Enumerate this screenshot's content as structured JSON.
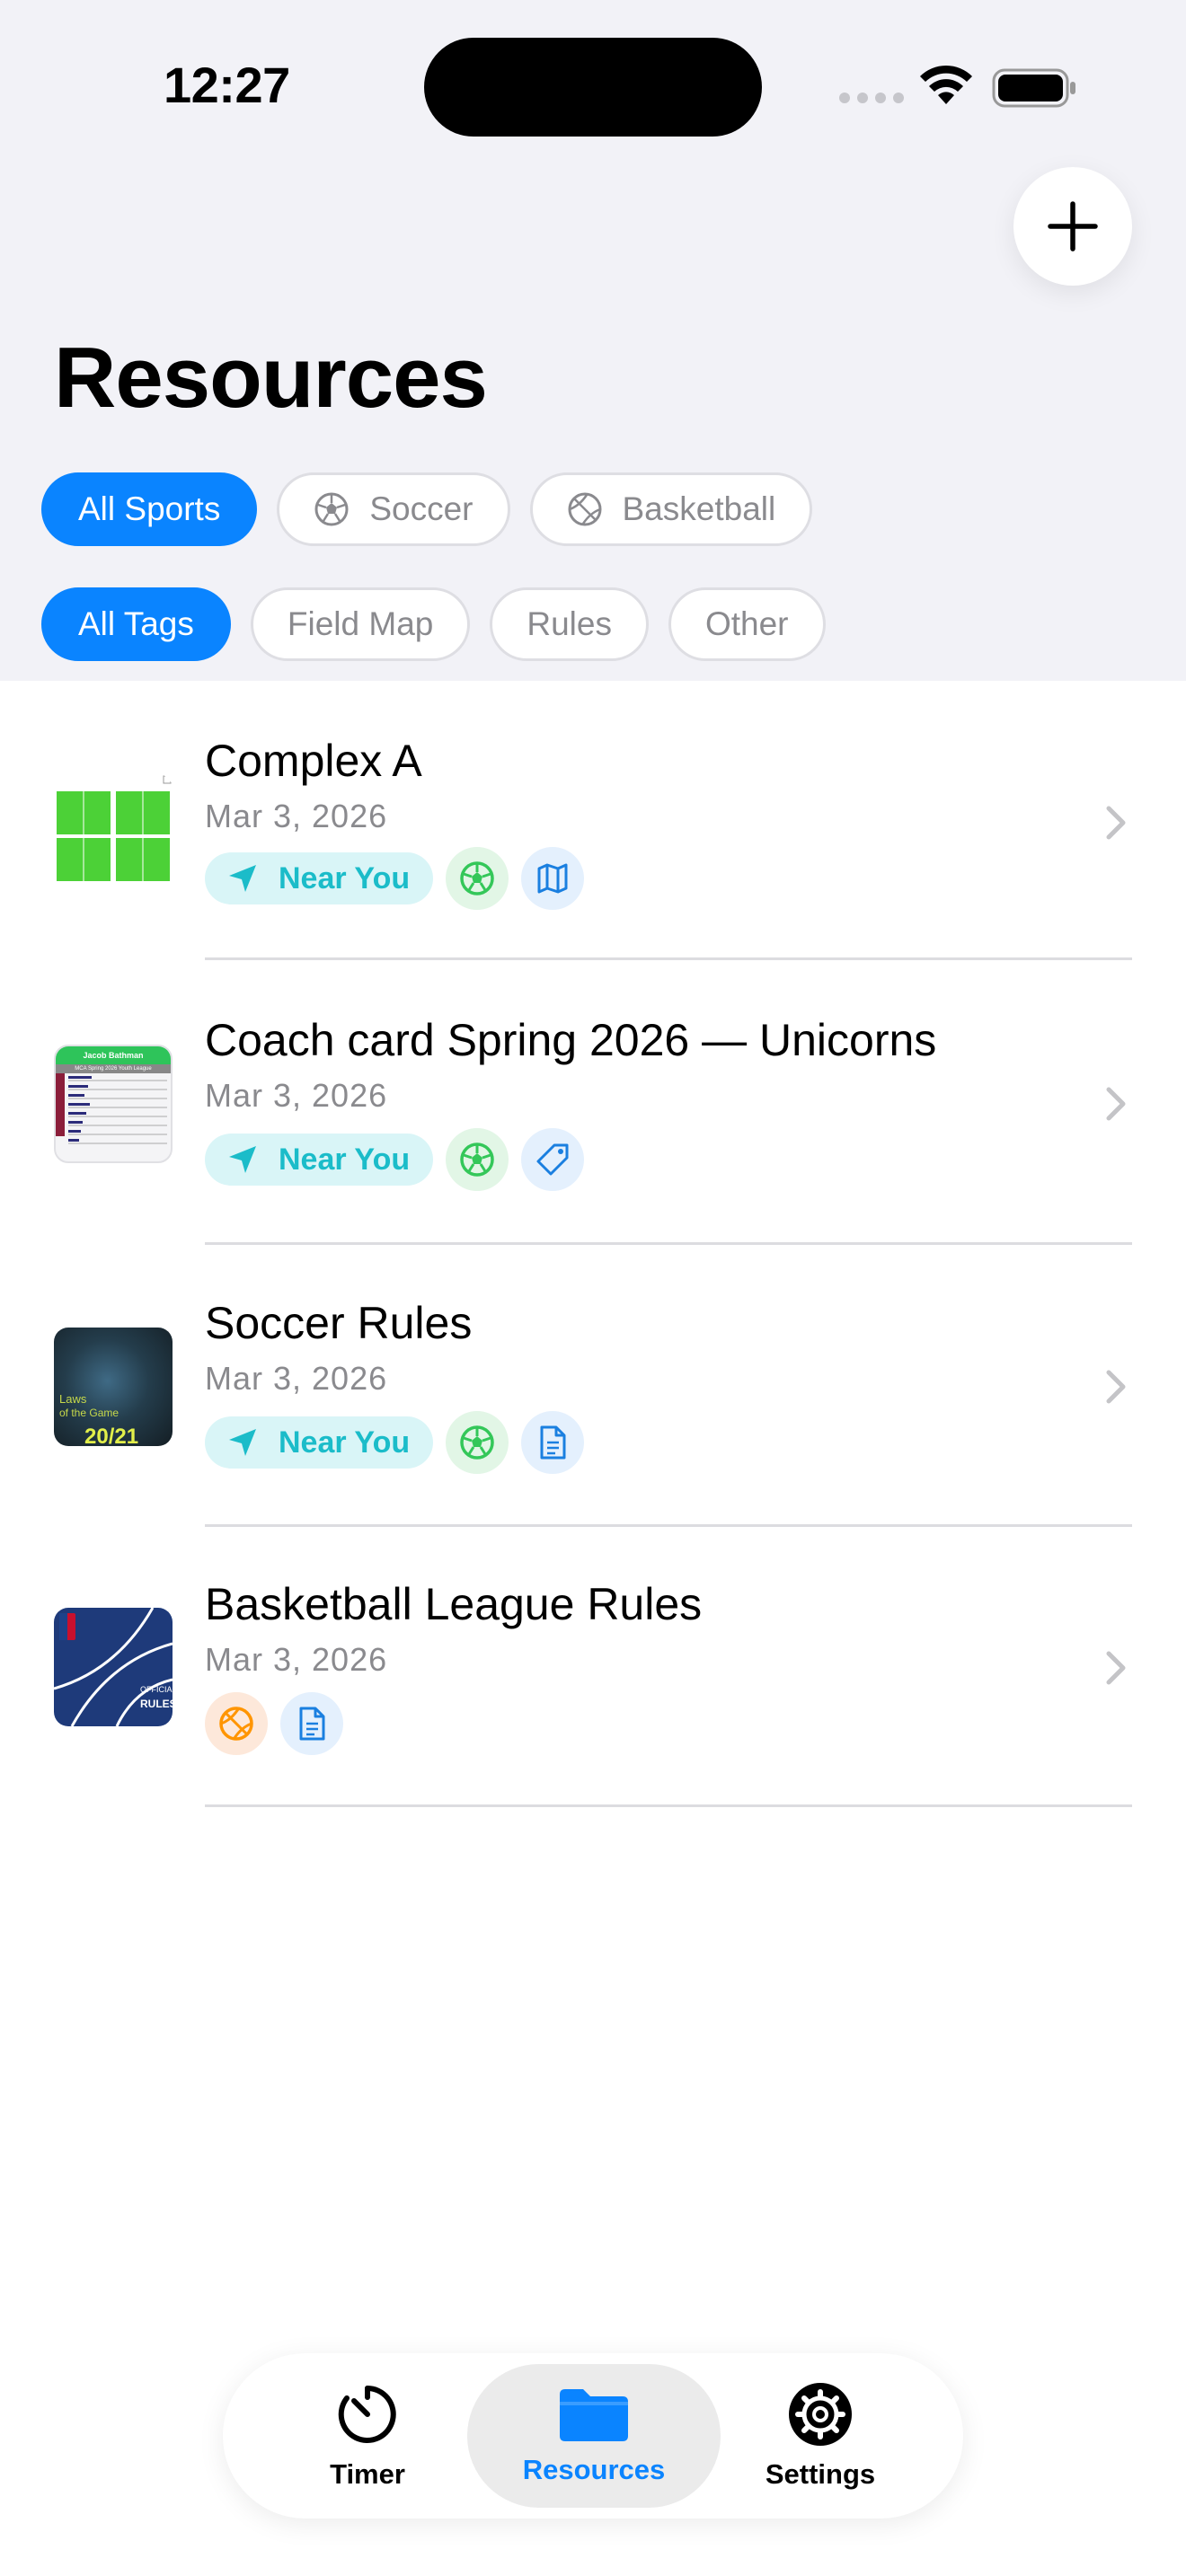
{
  "status_bar": {
    "time": "12:27"
  },
  "page": {
    "title": "Resources"
  },
  "filters": {
    "sports": [
      {
        "label": "All Sports",
        "active": true,
        "icon": ""
      },
      {
        "label": "Soccer",
        "active": false,
        "icon": "soccer-ball-icon"
      },
      {
        "label": "Basketball",
        "active": false,
        "icon": "basketball-icon"
      }
    ],
    "tags": [
      {
        "label": "All Tags",
        "active": true
      },
      {
        "label": "Field Map",
        "active": false
      },
      {
        "label": "Rules",
        "active": false
      },
      {
        "label": "Other",
        "active": false
      }
    ]
  },
  "resources": [
    {
      "title": "Complex A",
      "date": "Mar 3, 2026",
      "near_you": "Near You",
      "sport_icon": "soccer-ball-icon",
      "tag_icon": "map-icon"
    },
    {
      "title": " Coach card Spring 2026 — Unicorns",
      "date": "Mar 3, 2026",
      "near_you": "Near You",
      "sport_icon": "soccer-ball-icon",
      "tag_icon": "tag-icon",
      "thumb_header": "Jacob Bathman",
      "thumb_sub": "MCA Spring 2026 Youth League"
    },
    {
      "title": "Soccer Rules",
      "date": "Mar 3, 2026",
      "near_you": "Near You",
      "sport_icon": "soccer-ball-icon",
      "tag_icon": "document-icon",
      "thumb_text_1": "Laws",
      "thumb_text_2": "of the Game",
      "thumb_text_3": "20/21"
    },
    {
      "title": "Basketball League Rules",
      "date": "Mar 3, 2026",
      "near_you": "",
      "sport_icon": "basketball-icon",
      "tag_icon": "document-icon",
      "thumb_text_1": "OFFICIAL",
      "thumb_text_2": "RULES"
    }
  ],
  "tabbar": {
    "timer": "Timer",
    "resources": "Resources",
    "settings": "Settings"
  },
  "colors": {
    "accent": "#0a84ff",
    "near_you": "#1bbcc9",
    "soccer": "#34c759",
    "basketball": "#ff9500"
  }
}
